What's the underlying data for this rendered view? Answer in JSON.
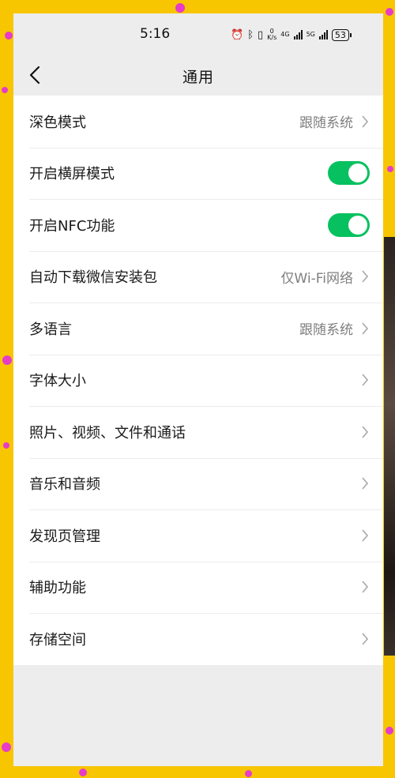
{
  "status_bar": {
    "time": "5:16",
    "speed_value": "0",
    "speed_unit": "K/s",
    "net1": "4G",
    "net2": "5G",
    "battery": "53"
  },
  "header": {
    "title": "通用",
    "back_icon": "chevron-left-icon"
  },
  "settings": [
    {
      "label": "深色模式",
      "value": "跟随系统"
    },
    {
      "label": "开启横屏模式",
      "toggle": "on"
    },
    {
      "label": "开启NFC功能",
      "toggle": "on"
    },
    {
      "label": "自动下载微信安装包",
      "value": "仅Wi-Fi网络"
    },
    {
      "label": "多语言",
      "value": "跟随系统"
    },
    {
      "label": "字体大小"
    },
    {
      "label": "照片、视频、文件和通话"
    },
    {
      "label": "音乐和音频"
    },
    {
      "label": "发现页管理"
    },
    {
      "label": "辅助功能"
    },
    {
      "label": "存储空间"
    }
  ],
  "colors": {
    "toggle_on": "#07c160",
    "background_frame": "#f7c600",
    "page_bg": "#ededed"
  }
}
